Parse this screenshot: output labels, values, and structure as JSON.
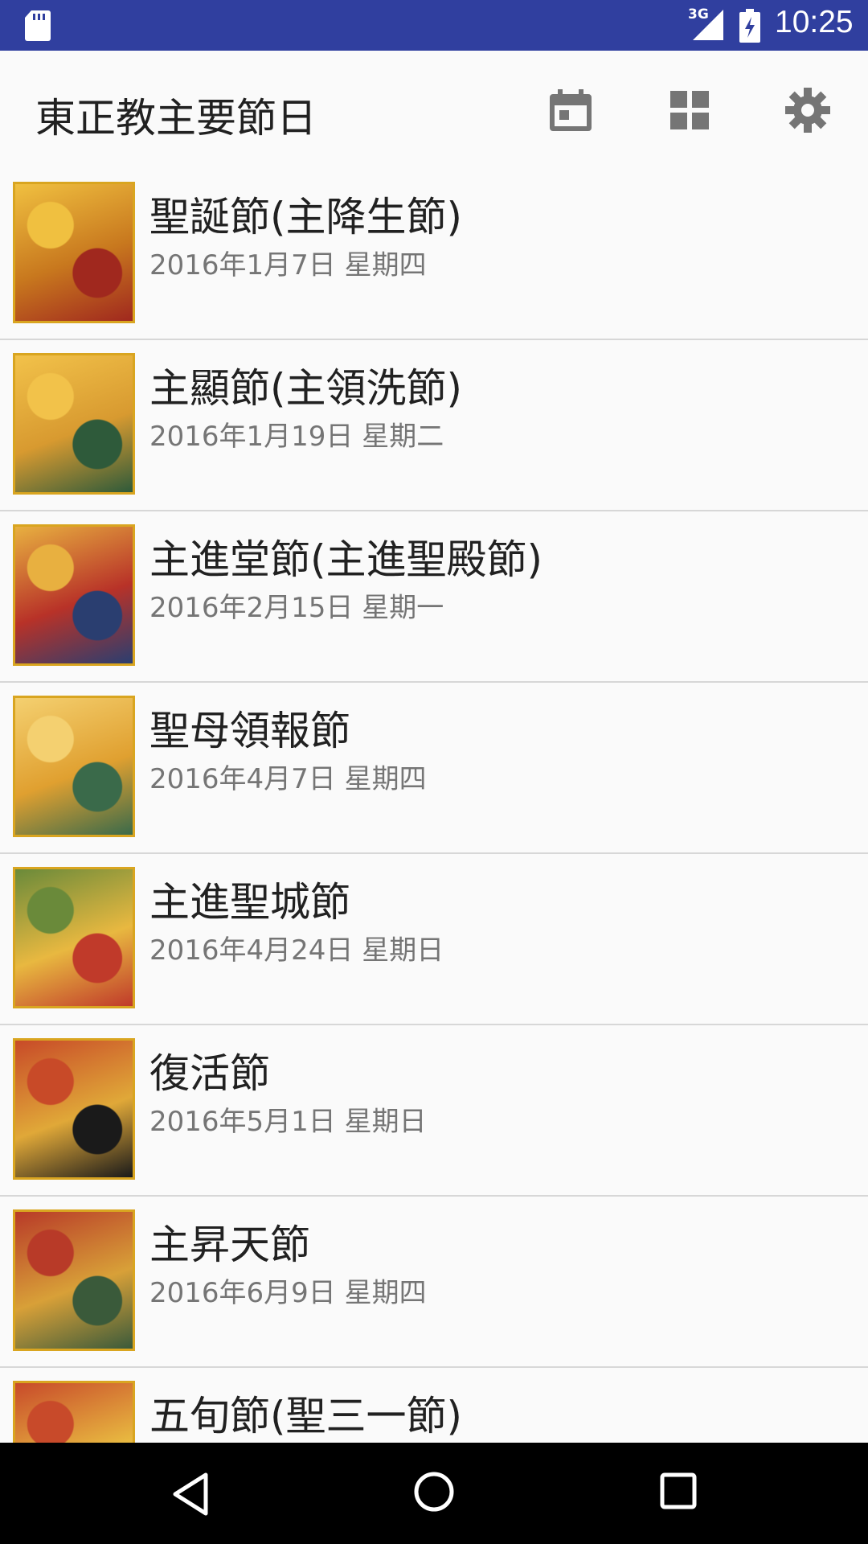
{
  "colors": {
    "status_bar": "#303f9f",
    "background": "#fafafa",
    "title_text": "#212121",
    "secondary_text": "#757575",
    "icon_grey": "#757575",
    "divider": "#d7d7d7",
    "icon_frame_gold": "#d9a520"
  },
  "status_bar": {
    "network": "3G",
    "time": "10:25",
    "icons": [
      "sd-card-icon",
      "signal-icon",
      "battery-charging-icon"
    ]
  },
  "app_bar": {
    "title": "東正教主要節日",
    "actions": [
      "calendar-icon",
      "grid-icon",
      "gear-icon"
    ]
  },
  "feasts": [
    {
      "name": "聖誕節(主降生節)",
      "date": "2016年1月7日 星期四",
      "thumb_colors": [
        "#c8781e",
        "#f0c040",
        "#a0281e"
      ]
    },
    {
      "name": "主顯節(主領洗節)",
      "date": "2016年1月19日 星期二",
      "thumb_colors": [
        "#d89a30",
        "#f2c24a",
        "#2e5a3a"
      ]
    },
    {
      "name": "主進堂節(主進聖殿節)",
      "date": "2016年2月15日 星期一",
      "thumb_colors": [
        "#b83228",
        "#e8b040",
        "#2a3e70"
      ]
    },
    {
      "name": "聖母領報節",
      "date": "2016年4月7日 星期四",
      "thumb_colors": [
        "#e0a030",
        "#f4d070",
        "#3a6a4a"
      ]
    },
    {
      "name": "主進聖城節",
      "date": "2016年4月24日 星期日",
      "thumb_colors": [
        "#e8b840",
        "#6a8a3a",
        "#c03a2a"
      ]
    },
    {
      "name": "復活節",
      "date": "2016年5月1日 星期日",
      "thumb_colors": [
        "#e0a838",
        "#c84a28",
        "#1a1a1a"
      ]
    },
    {
      "name": "主昇天節",
      "date": "2016年6月9日 星期四",
      "thumb_colors": [
        "#d8a038",
        "#b83a28",
        "#3a5a3a"
      ]
    },
    {
      "name": "五旬節(聖三一節)",
      "date": "",
      "thumb_colors": [
        "#e8b840",
        "#c84a2a",
        "#f0d060"
      ]
    }
  ],
  "nav_bar": {
    "buttons": [
      "back-icon",
      "home-icon",
      "recents-icon"
    ]
  }
}
